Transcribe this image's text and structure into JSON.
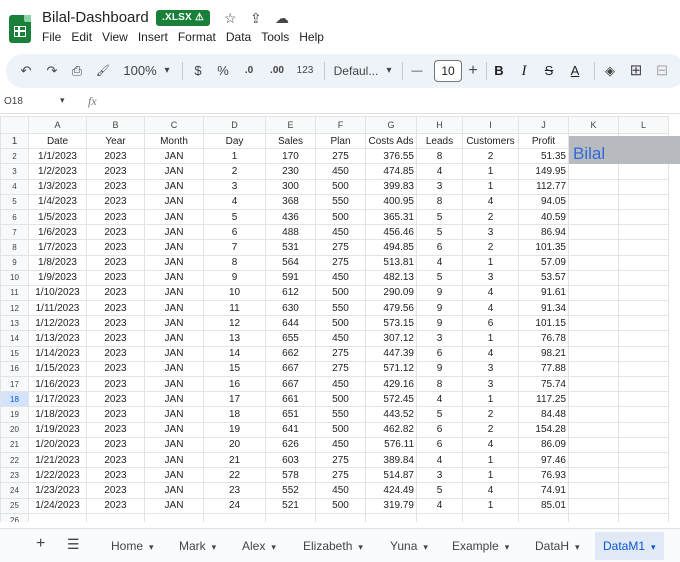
{
  "window": {
    "doc_title": "Bilal-Dashboard",
    "file_badge": ".XLSX",
    "badge_icon": "⚠",
    "star_icon": "☆",
    "move_icon": "⇪",
    "cloud_icon": "☁",
    "brand_color": "#188038",
    "accent_color": "#0b57d0"
  },
  "menu": [
    "File",
    "Edit",
    "View",
    "Insert",
    "Format",
    "Data",
    "Tools",
    "Help"
  ],
  "toolbar": {
    "undo": "↶",
    "redo": "↷",
    "print": "⎙",
    "paint": "🖌",
    "zoom": "100%",
    "caret": "▾",
    "currency": "$",
    "percent": "%",
    "dec_decrease": ".0",
    "dec_increase": ".00",
    "number_format": "123",
    "font": "Defaul...",
    "minus": "—",
    "font_size": "10",
    "plus": "+",
    "bold": "B",
    "italic": "I",
    "strike": "S",
    "text_color": "A",
    "fill": "◈",
    "borders": "⊞",
    "merge": "⊟"
  },
  "formula_bar": {
    "cell_ref": "O18",
    "caret": "▾",
    "fx": "fx"
  },
  "columns": [
    "A",
    "B",
    "C",
    "D",
    "E",
    "F",
    "G",
    "H",
    "I",
    "J",
    "K",
    "L"
  ],
  "header_row": [
    "Date",
    "Year",
    "Month",
    "Day",
    "Sales",
    "Plan",
    "Costs Ads",
    "Leads",
    "Customers",
    "Profit"
  ],
  "banner_text": "Bilal",
  "rows": [
    [
      "1/1/2023",
      "2023",
      "JAN",
      "1",
      "170",
      "275",
      "376.55",
      "8",
      "2",
      "51.35"
    ],
    [
      "1/2/2023",
      "2023",
      "JAN",
      "2",
      "230",
      "450",
      "474.85",
      "4",
      "1",
      "149.95"
    ],
    [
      "1/3/2023",
      "2023",
      "JAN",
      "3",
      "300",
      "500",
      "399.83",
      "3",
      "1",
      "112.77"
    ],
    [
      "1/4/2023",
      "2023",
      "JAN",
      "4",
      "368",
      "550",
      "400.95",
      "8",
      "4",
      "94.05"
    ],
    [
      "1/5/2023",
      "2023",
      "JAN",
      "5",
      "436",
      "500",
      "365.31",
      "5",
      "2",
      "40.59"
    ],
    [
      "1/6/2023",
      "2023",
      "JAN",
      "6",
      "488",
      "450",
      "456.46",
      "5",
      "3",
      "86.94"
    ],
    [
      "1/7/2023",
      "2023",
      "JAN",
      "7",
      "531",
      "275",
      "494.85",
      "6",
      "2",
      "101.35"
    ],
    [
      "1/8/2023",
      "2023",
      "JAN",
      "8",
      "564",
      "275",
      "513.81",
      "4",
      "1",
      "57.09"
    ],
    [
      "1/9/2023",
      "2023",
      "JAN",
      "9",
      "591",
      "450",
      "482.13",
      "5",
      "3",
      "53.57"
    ],
    [
      "1/10/2023",
      "2023",
      "JAN",
      "10",
      "612",
      "500",
      "290.09",
      "9",
      "4",
      "91.61"
    ],
    [
      "1/11/2023",
      "2023",
      "JAN",
      "11",
      "630",
      "550",
      "479.56",
      "9",
      "4",
      "91.34"
    ],
    [
      "1/12/2023",
      "2023",
      "JAN",
      "12",
      "644",
      "500",
      "573.15",
      "9",
      "6",
      "101.15"
    ],
    [
      "1/13/2023",
      "2023",
      "JAN",
      "13",
      "655",
      "450",
      "307.12",
      "3",
      "1",
      "76.78"
    ],
    [
      "1/14/2023",
      "2023",
      "JAN",
      "14",
      "662",
      "275",
      "447.39",
      "6",
      "4",
      "98.21"
    ],
    [
      "1/15/2023",
      "2023",
      "JAN",
      "15",
      "667",
      "275",
      "571.12",
      "9",
      "3",
      "77.88"
    ],
    [
      "1/16/2023",
      "2023",
      "JAN",
      "16",
      "667",
      "450",
      "429.16",
      "8",
      "3",
      "75.74"
    ],
    [
      "1/17/2023",
      "2023",
      "JAN",
      "17",
      "661",
      "500",
      "572.45",
      "4",
      "1",
      "117.25"
    ],
    [
      "1/18/2023",
      "2023",
      "JAN",
      "18",
      "651",
      "550",
      "443.52",
      "5",
      "2",
      "84.48"
    ],
    [
      "1/19/2023",
      "2023",
      "JAN",
      "19",
      "641",
      "500",
      "462.82",
      "6",
      "2",
      "154.28"
    ],
    [
      "1/20/2023",
      "2023",
      "JAN",
      "20",
      "626",
      "450",
      "576.11",
      "6",
      "4",
      "86.09"
    ],
    [
      "1/21/2023",
      "2023",
      "JAN",
      "21",
      "603",
      "275",
      "389.84",
      "4",
      "1",
      "97.46"
    ],
    [
      "1/22/2023",
      "2023",
      "JAN",
      "22",
      "578",
      "275",
      "514.87",
      "3",
      "1",
      "76.93"
    ],
    [
      "1/23/2023",
      "2023",
      "JAN",
      "23",
      "552",
      "450",
      "424.49",
      "5",
      "4",
      "74.91"
    ],
    [
      "1/24/2023",
      "2023",
      "JAN",
      "24",
      "521",
      "500",
      "319.79",
      "4",
      "1",
      "85.01"
    ]
  ],
  "selected_row": "18",
  "bottom_bar": {
    "add_icon": "+",
    "list_icon": "☰",
    "caret": "▾",
    "tabs": [
      "Home",
      "Mark",
      "Alex",
      "Elizabeth",
      "Yuna",
      "Example",
      "DataH",
      "DataM1"
    ],
    "active_tab": "DataM1"
  }
}
